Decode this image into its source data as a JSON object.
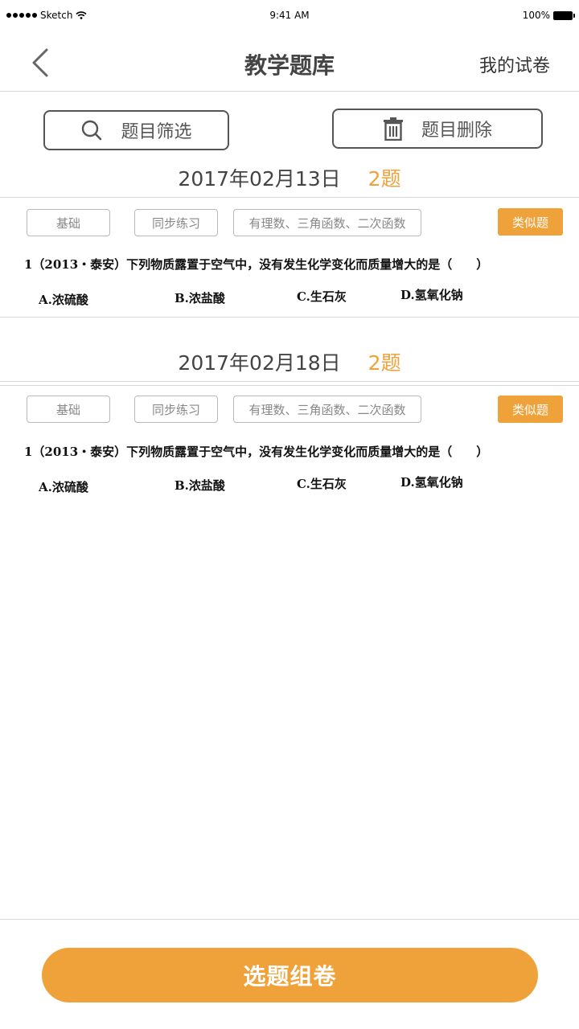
{
  "status_bar": {
    "carrier": "Sketch",
    "time": "9:41 AM",
    "battery": "100%"
  },
  "nav": {
    "title": "教学题库",
    "right_label": "我的试卷"
  },
  "toolbar": {
    "filter_label": "题目筛选",
    "delete_label": "题目删除"
  },
  "groups": [
    {
      "date": "2017年02月13日",
      "count": "2题",
      "tags": [
        "基础",
        "同步练习",
        "有理数、三角函数、二次函数"
      ],
      "similar_label": "类似题",
      "question": "1（2013・泰安）下列物质露置于空气中，没有发生化学变化而质量增大的是（　　）",
      "options": [
        "A.浓硫酸",
        "B.浓盐酸",
        "C.生石灰",
        "D.氢氧化钠"
      ]
    },
    {
      "date": "2017年02月18日",
      "count": "2题",
      "tags": [
        "基础",
        "同步练习",
        "有理数、三角函数、二次函数"
      ],
      "similar_label": "类似题",
      "question": "1（2013・泰安）下列物质露置于空气中，没有发生化学变化而质量增大的是（　　）",
      "options": [
        "A.浓硫酸",
        "B.浓盐酸",
        "C.生石灰",
        "D.氢氧化钠"
      ]
    }
  ],
  "footer": {
    "compose_label": "选题组卷"
  },
  "colors": {
    "accent": "#f0a23a",
    "divider": "#d6d6d6"
  },
  "icons": [
    "back-chevron-icon",
    "search-icon",
    "trash-icon",
    "wifi-icon",
    "battery-icon"
  ]
}
